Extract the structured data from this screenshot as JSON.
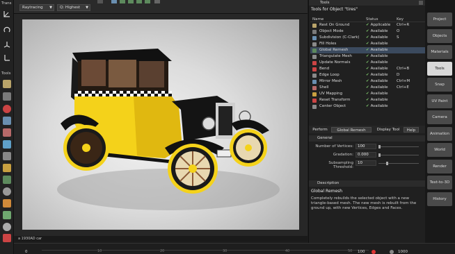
{
  "toolbar": {
    "render_mode": "Raytracing",
    "quality": "Q: Highest"
  },
  "left_bar": {
    "transform_label": "Trans",
    "tools_label": "Tools"
  },
  "viewport": {
    "status_text": "a 1930AD car"
  },
  "timeline": {
    "current_frame": "0",
    "ticks": [
      "10",
      "20",
      "30",
      "40",
      "50"
    ],
    "end_frame": "100",
    "fps": "1000"
  },
  "tools_panel": {
    "title": "Tools",
    "subtitle": "Tools for Object \"tires\"",
    "columns": {
      "name": "Name",
      "status": "Status",
      "key": "Key"
    },
    "rows": [
      {
        "name": "Rest On Ground",
        "status": "Applicable",
        "key": "Ctrl+R",
        "icon_color": "#b9a46a"
      },
      {
        "name": "Object Mode",
        "status": "Available",
        "key": "O",
        "icon_color": "#7a7a7a"
      },
      {
        "name": "Subdivision (C-Clark)",
        "status": "Available",
        "key": "S",
        "icon_color": "#6a8fb0"
      },
      {
        "name": "Fill Holes",
        "status": "Available",
        "key": "",
        "icon_color": "#8a8a8a"
      },
      {
        "name": "Global Remesh",
        "status": "Available",
        "key": "",
        "icon_color": "#5d8a5d"
      },
      {
        "name": "Triangulate Mesh",
        "status": "Available",
        "key": "",
        "icon_color": "#8a8a8a"
      },
      {
        "name": "Update Normals",
        "status": "Available",
        "key": "",
        "icon_color": "#c44"
      },
      {
        "name": "Bend",
        "status": "Available",
        "key": "Ctrl+B",
        "icon_color": "#c44"
      },
      {
        "name": "Edge Loop",
        "status": "Available",
        "key": "D",
        "icon_color": "#8a8a8a"
      },
      {
        "name": "Mirror Mesh",
        "status": "Available",
        "key": "Ctrl+M",
        "icon_color": "#6a8fb0"
      },
      {
        "name": "Shell",
        "status": "Available",
        "key": "Ctrl+E",
        "icon_color": "#b86a6a"
      },
      {
        "name": "UV Mapping",
        "status": "Available",
        "key": "",
        "icon_color": "#c8a040"
      },
      {
        "name": "Reset Transform",
        "status": "Available",
        "key": "",
        "icon_color": "#c44"
      },
      {
        "name": "Center Object",
        "status": "Available",
        "key": "",
        "icon_color": "#8a8a8a"
      }
    ],
    "perform_label": "Perform",
    "perform_target": "Global Remesh",
    "display_tool_label": "Display Tool",
    "help_label": "Help",
    "general_header": "General",
    "params": [
      {
        "label": "Number of Vertices:",
        "value": "100",
        "fill": 0.0
      },
      {
        "label": "Gradation:",
        "value": "0.000",
        "fill": 0.0
      },
      {
        "label": "Subsampling Threshold:",
        "value": "10",
        "fill": 0.2
      }
    ],
    "description_header": "Description",
    "description_title": "Global Remesh",
    "description_text": "Completely rebuilds the selected object with a new triangle-based mesh. The new mesh is rebuilt from the ground up, with new Vertices, Edges and Faces."
  },
  "right_tabs": [
    {
      "label": "Project",
      "active": false
    },
    {
      "label": "Objects",
      "active": false
    },
    {
      "label": "Materials",
      "active": false
    },
    {
      "label": "Tools",
      "active": true
    },
    {
      "label": "Snap",
      "active": false
    },
    {
      "label": "UV Paint",
      "active": false
    },
    {
      "label": "Camera",
      "active": false
    },
    {
      "label": "Animation",
      "active": false
    },
    {
      "label": "World",
      "active": false
    },
    {
      "label": "Render",
      "active": false
    },
    {
      "label": "Text-to-3D",
      "active": false
    },
    {
      "label": "History",
      "active": false
    }
  ],
  "colors": {
    "selected_row": "#3b4a5e",
    "status_check": "#7cc36a",
    "active_tab": "#d9d9d9",
    "car_body": "#f4d21a"
  }
}
